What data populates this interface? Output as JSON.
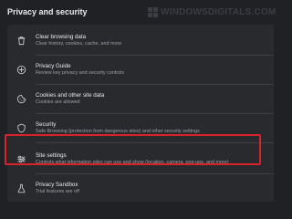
{
  "section_title": "Privacy and security",
  "watermark": "WINDOWSDIGITALS.COM",
  "rows": [
    {
      "title": "Clear browsing data",
      "subtitle": "Clear history, cookies, cache, and more",
      "icon": "trash-icon"
    },
    {
      "title": "Privacy Guide",
      "subtitle": "Review key privacy and security controls",
      "icon": "privacy-guide-icon"
    },
    {
      "title": "Cookies and other site data",
      "subtitle": "Cookies are allowed",
      "icon": "cookie-icon"
    },
    {
      "title": "Security",
      "subtitle": "Safe Browsing (protection from dangerous sites) and other security settings",
      "icon": "shield-icon"
    },
    {
      "title": "Site settings",
      "subtitle": "Controls what information sites can use and show (location, camera, pop-ups, and more)",
      "icon": "sliders-icon",
      "highlighted": true
    },
    {
      "title": "Privacy Sandbox",
      "subtitle": "Trial features are off",
      "icon": "flask-icon"
    }
  ],
  "colors": {
    "background": "#202124",
    "card": "#292a2d",
    "text_primary": "#e8eaed",
    "text_secondary": "#9aa0a6",
    "highlight_border": "#d8232a"
  }
}
